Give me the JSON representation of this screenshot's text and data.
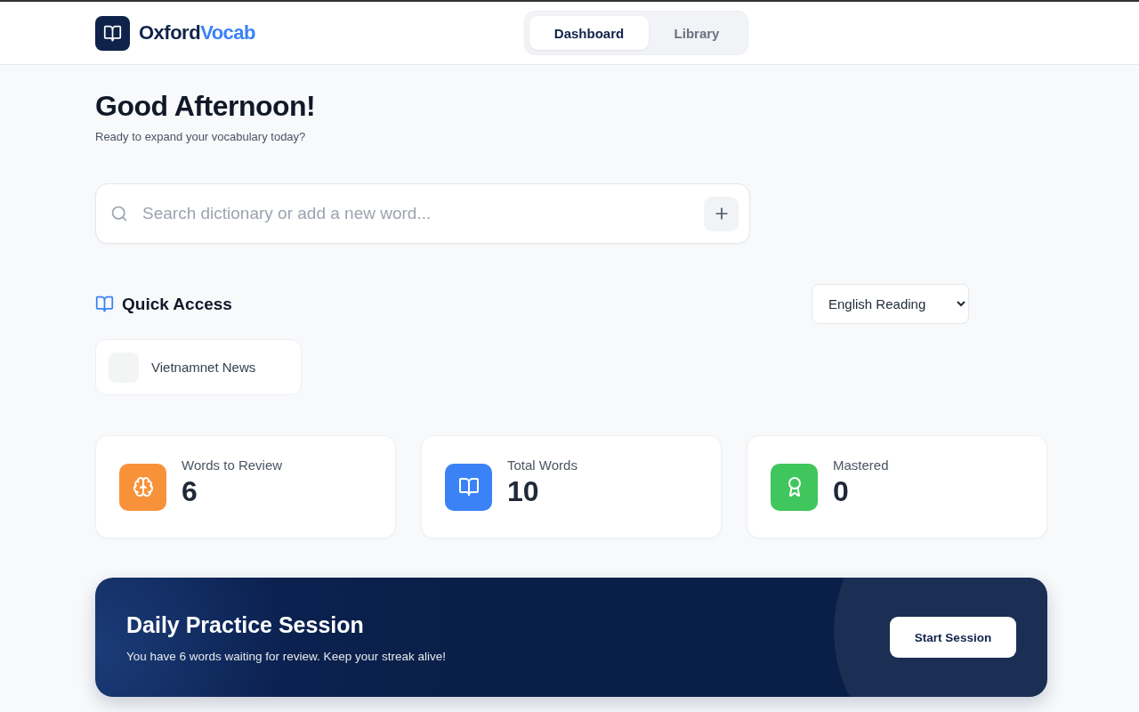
{
  "brand": {
    "name": "Oxford",
    "accent": "Vocab"
  },
  "tabs": [
    {
      "label": "Dashboard",
      "selected": true
    },
    {
      "label": "Library",
      "selected": false
    }
  ],
  "greeting": {
    "title": "Good Afternoon!",
    "subtitle": "Ready to expand your vocabulary today?"
  },
  "search": {
    "placeholder": "Search dictionary or add a new word..."
  },
  "quick_access": {
    "title": "Quick Access",
    "filter": "English Reading",
    "items": [
      {
        "label": "Vietnamnet News"
      }
    ]
  },
  "stats": [
    {
      "kind": "brain",
      "color": "#f7923b",
      "label": "Words to Review",
      "value": "6"
    },
    {
      "kind": "book",
      "color": "#3b82f6",
      "label": "Total Words",
      "value": "10"
    },
    {
      "kind": "award",
      "color": "#3fc65c",
      "label": "Mastered",
      "value": "0"
    }
  ],
  "practice": {
    "title": "Daily Practice Session",
    "text": "You have 6 words waiting for review. Keep your streak alive!",
    "button": "Start Session"
  }
}
